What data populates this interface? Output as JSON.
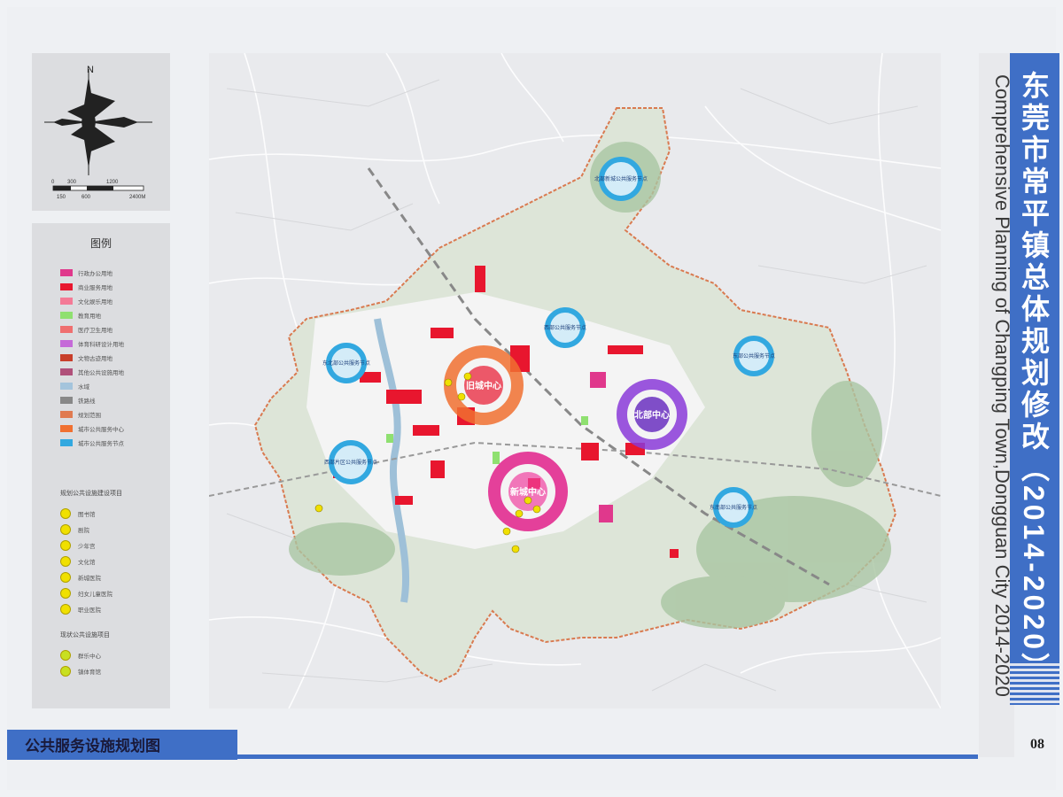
{
  "title": {
    "cn": "东莞市常平镇总体规划修改（2014-2020）",
    "en": "Comprehensive Planning of Changping Town,Dongguan City  2014-2020"
  },
  "page_number": "08",
  "bottom_label": "公共服务设施规划图",
  "compass": {
    "north_label": "N",
    "scale_top": [
      "0",
      "300",
      "1200"
    ],
    "scale_bottom": [
      "150",
      "600",
      "2400M"
    ]
  },
  "legend": {
    "title": "图例",
    "items": [
      {
        "label": "行政办公用地",
        "color": "#e0388c"
      },
      {
        "label": "商业服务用地",
        "color": "#e8162e"
      },
      {
        "label": "文化娱乐用地",
        "color": "#f47a96"
      },
      {
        "label": "教育用地",
        "color": "#8fe070"
      },
      {
        "label": "医疗卫生用地",
        "color": "#ef6f6f"
      },
      {
        "label": "体育科研设计用地",
        "color": "#c56ad8"
      },
      {
        "label": "文物古迹用地",
        "color": "#c83e2a"
      },
      {
        "label": "其他公共设施用地",
        "color": "#b0507a"
      },
      {
        "label": "水域",
        "color": "#a4c4dc"
      },
      {
        "label": "铁路线",
        "color": "#888888"
      },
      {
        "label": "规划范围",
        "color": "#e07a50"
      },
      {
        "label": "城市公共服务中心",
        "color": "#f07030"
      },
      {
        "label": "城市公共服务节点",
        "color": "#32a8e0"
      }
    ],
    "planned_heading": "规划公共设施建设项目",
    "planned_items": [
      "图书馆",
      "剧院",
      "少年宫",
      "文化馆",
      "新城医院",
      "妇女儿童医院",
      "职业医院"
    ],
    "existing_heading": "现状公共设施项目",
    "existing_items": [
      "群乐中心",
      "镇体育馆"
    ]
  },
  "map": {
    "centers": [
      {
        "label": "旧城中心",
        "color": "#f07030"
      },
      {
        "label": "新城中心",
        "color": "#e0208a"
      },
      {
        "label": "北部中心",
        "color": "#8a3ad8"
      }
    ],
    "nodes": [
      {
        "label": "北部新城公共服务节点"
      },
      {
        "label": "西部公共服务节点"
      },
      {
        "label": "东部公共服务节点"
      },
      {
        "label": "西部片区公共服务节点"
      },
      {
        "label": "东北部公共服务节点"
      },
      {
        "label": "东南部公共服务节点"
      }
    ]
  }
}
